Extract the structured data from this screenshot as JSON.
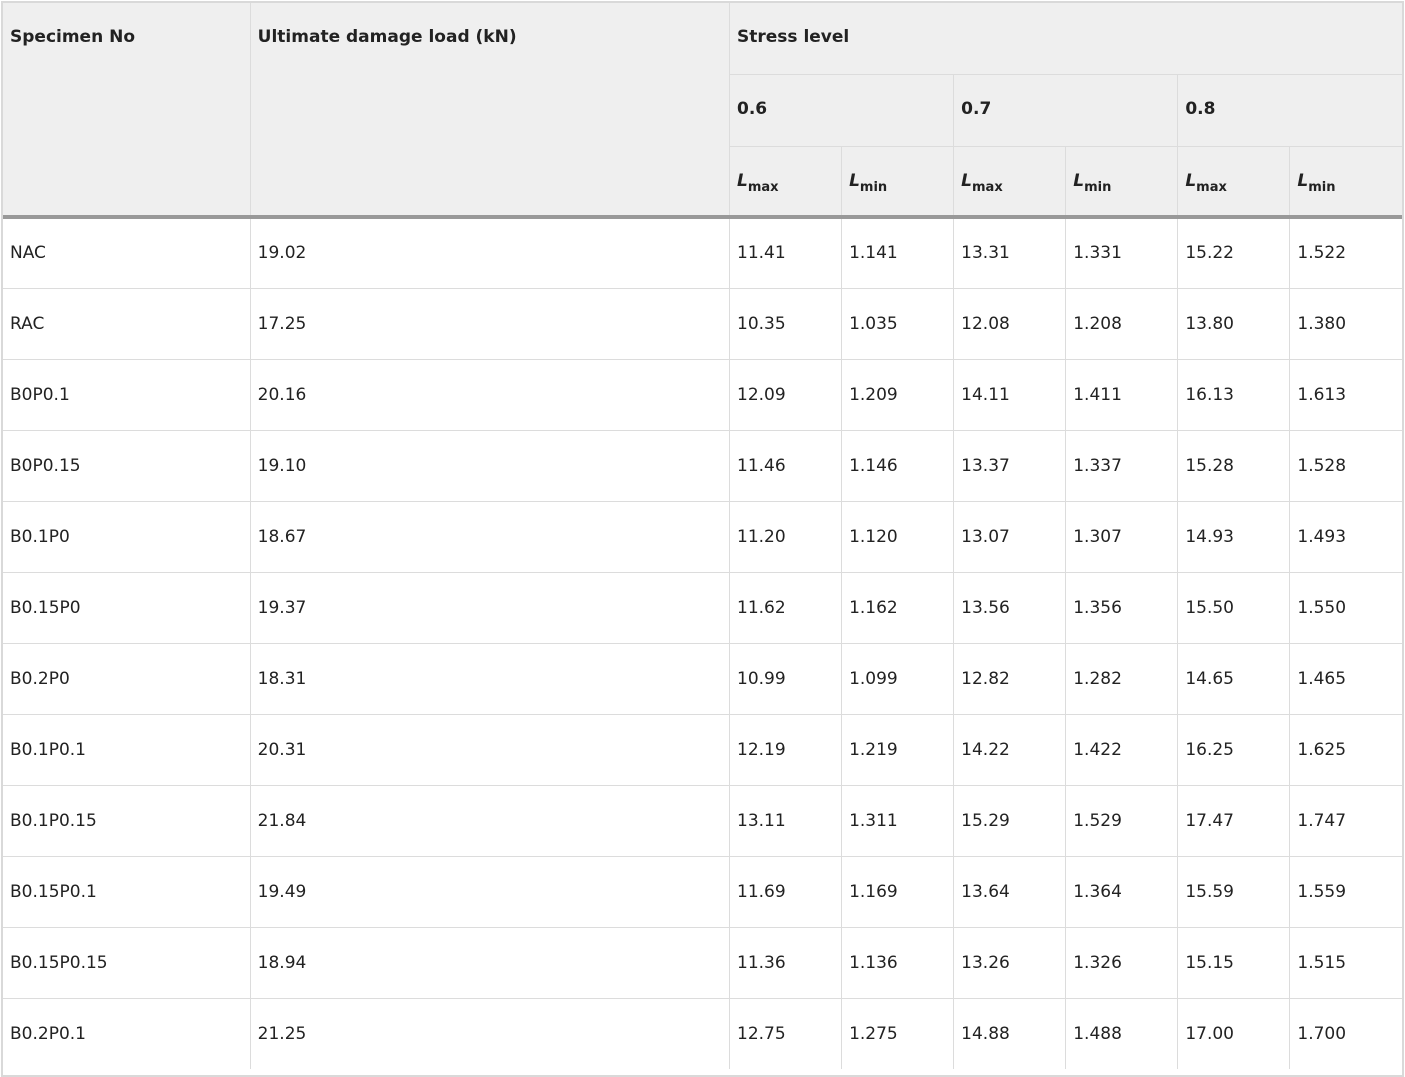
{
  "headers": {
    "specimen": "Specimen No",
    "ultimate": "Ultimate damage load (kN)",
    "stress_level": "Stress level",
    "levels": [
      "0.6",
      "0.7",
      "0.8"
    ],
    "l_symbol": "L",
    "max_sub": "max",
    "min_sub": "min"
  },
  "rows": [
    {
      "id": "NAC",
      "load": "19.02",
      "v": [
        "11.41",
        "1.141",
        "13.31",
        "1.331",
        "15.22",
        "1.522"
      ]
    },
    {
      "id": "RAC",
      "load": "17.25",
      "v": [
        "10.35",
        "1.035",
        "12.08",
        "1.208",
        "13.80",
        "1.380"
      ]
    },
    {
      "id": "B0P0.1",
      "load": "20.16",
      "v": [
        "12.09",
        "1.209",
        "14.11",
        "1.411",
        "16.13",
        "1.613"
      ]
    },
    {
      "id": "B0P0.15",
      "load": "19.10",
      "v": [
        "11.46",
        "1.146",
        "13.37",
        "1.337",
        "15.28",
        "1.528"
      ]
    },
    {
      "id": "B0.1P0",
      "load": "18.67",
      "v": [
        "11.20",
        "1.120",
        "13.07",
        "1.307",
        "14.93",
        "1.493"
      ]
    },
    {
      "id": "B0.15P0",
      "load": "19.37",
      "v": [
        "11.62",
        "1.162",
        "13.56",
        "1.356",
        "15.50",
        "1.550"
      ]
    },
    {
      "id": "B0.2P0",
      "load": "18.31",
      "v": [
        "10.99",
        "1.099",
        "12.82",
        "1.282",
        "14.65",
        "1.465"
      ]
    },
    {
      "id": "B0.1P0.1",
      "load": "20.31",
      "v": [
        "12.19",
        "1.219",
        "14.22",
        "1.422",
        "16.25",
        "1.625"
      ]
    },
    {
      "id": "B0.1P0.15",
      "load": "21.84",
      "v": [
        "13.11",
        "1.311",
        "15.29",
        "1.529",
        "17.47",
        "1.747"
      ]
    },
    {
      "id": "B0.15P0.1",
      "load": "19.49",
      "v": [
        "11.69",
        "1.169",
        "13.64",
        "1.364",
        "15.59",
        "1.559"
      ]
    },
    {
      "id": "B0.15P0.15",
      "load": "18.94",
      "v": [
        "11.36",
        "1.136",
        "13.26",
        "1.326",
        "15.15",
        "1.515"
      ]
    },
    {
      "id": "B0.2P0.1",
      "load": "21.25",
      "v": [
        "12.75",
        "1.275",
        "14.88",
        "1.488",
        "17.00",
        "1.700"
      ]
    }
  ]
}
